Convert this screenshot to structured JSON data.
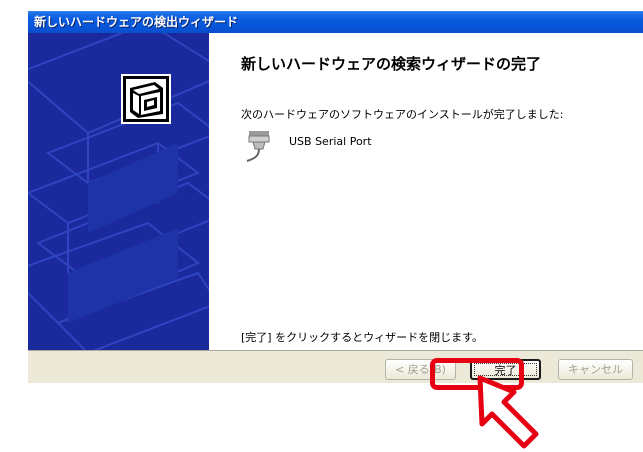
{
  "window": {
    "title": "新しいハードウェアの検出ウィザード"
  },
  "content": {
    "heading": "新しいハードウェアの検索ウィザードの完了",
    "subtitle": "次のハードウェアのソフトウェアのインストールが完了しました:",
    "device_name": "USB Serial Port",
    "footer": "[完了] をクリックするとウィザードを閉じます。"
  },
  "buttons": {
    "back": "< 戻る(B)",
    "finish": "完了",
    "cancel": "キャンセル"
  },
  "icons": {
    "wizard": "hardware-wizard-icon",
    "device": "serial-port-icon",
    "cursor": "pointer-arrow-icon"
  },
  "colors": {
    "titlebar": "#0a5ce0",
    "left_panel": "#1a2a9c",
    "highlight": "#e60012",
    "dialog_bg": "#ece9d8"
  }
}
